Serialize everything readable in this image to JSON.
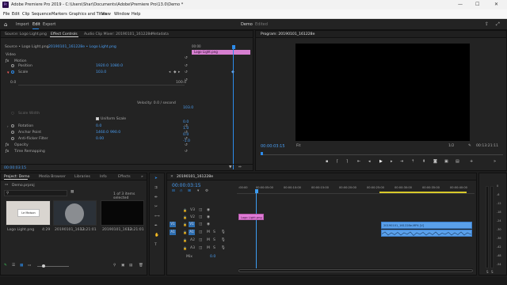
{
  "titlebar": {
    "title": "Adobe Premiere Pro 2019 - C:\\Users\\Shar\\Documents\\Adobe\\Premiere Pro\\13.0\\Demo *",
    "min": "—",
    "max": "☐",
    "close": "✕"
  },
  "menu": [
    "File",
    "Edit",
    "Clip",
    "Sequence",
    "Markers",
    "Graphics and Titles",
    "View",
    "Window",
    "Help"
  ],
  "workspaces": {
    "home_icon": "home-icon",
    "import": "Import",
    "edit": "Edit",
    "export": "Export",
    "project": "Demo",
    "edited": "Edited"
  },
  "effect_controls": {
    "tabs": [
      "Source: Logo Light.png",
      "Effect Controls",
      "Audio Clip Mixer: 20190101_161228e",
      "Metadata"
    ],
    "source_line": "Source • Logo Light.png",
    "clip_line": "20190101_161228e • Logo Light.png",
    "clip_label": "Logo Light.png",
    "ruler_start": "00:00",
    "video_heading": "Video",
    "motion": "Motion",
    "position_label": "Position",
    "position_x": "1920.0",
    "position_y": "1080.0",
    "scale_label": "Scale",
    "scale_val": "103.0",
    "zero": "0.0",
    "hundred": "100.0",
    "scale_width_label": "Scale Width",
    "uniform_scale": "Uniform Scale",
    "velocity": "Velocity: 0.0 / second",
    "rotation_label": "Rotation",
    "rotation_val": "0.0",
    "anchor_label": "Anchor Point",
    "anchor_x": "1460.0",
    "anchor_y": "990.0",
    "antiflicker_label": "Anti-flicker Filter",
    "antiflicker_val": "0.00",
    "opacity_label": "Opacity",
    "remap_label": "Time Remapping",
    "graph_vals": [
      "103.0",
      "0.0",
      "1.0",
      "0.0",
      "-1.0"
    ],
    "timecode": "00:00:03:15"
  },
  "program": {
    "title": "Program: 20190101_161228e",
    "timecode": "00:00:03:15",
    "fit": "Fit",
    "quality": "1/2",
    "duration": "00:13:21:11"
  },
  "project": {
    "tabs": [
      "Project: Demo",
      "Media Browser",
      "Libraries",
      "Info",
      "Effects"
    ],
    "name": "Demo.prproj",
    "selection": "1 of 3 items selected",
    "items": [
      {
        "name": "Logo Light.png",
        "dur": "4:29"
      },
      {
        "name": "20190101_1612...",
        "dur": "13:21:01"
      },
      {
        "name": "20190101_1612...",
        "dur": "13:21:01"
      }
    ]
  },
  "timeline": {
    "seq_name": "20190101_161228e",
    "timecode": "00:00:03:15",
    "ruler": [
      ":00:00",
      "00:00:05:00",
      "00:00:10:00",
      "00:00:15:00",
      "00:00:20:00",
      "00:00:25:00",
      "00:00:30:00",
      "00:00:35:00",
      "00:00:40:00"
    ],
    "tracks": [
      {
        "name": "V3"
      },
      {
        "name": "V2"
      },
      {
        "name": "V1"
      },
      {
        "name": "A1"
      },
      {
        "name": "A2"
      },
      {
        "name": "A3"
      }
    ],
    "v1_label": "V1",
    "a1_label": "A1",
    "mix_label": "Mix",
    "mix_val": "0.0",
    "logo_clip": "Logo Light.png",
    "video_clip": "20190101_161228e.MP4 [V]"
  },
  "meter_labels": [
    "0",
    "-6",
    "-12",
    "-18",
    "-24",
    "-30",
    "-36",
    "-42",
    "-48",
    "-54"
  ],
  "colors": {
    "accent": "#2d8ceb",
    "clip_pink": "#e07ad6",
    "clip_blue": "#5aa0ea",
    "playhead": "#3d9df2"
  }
}
